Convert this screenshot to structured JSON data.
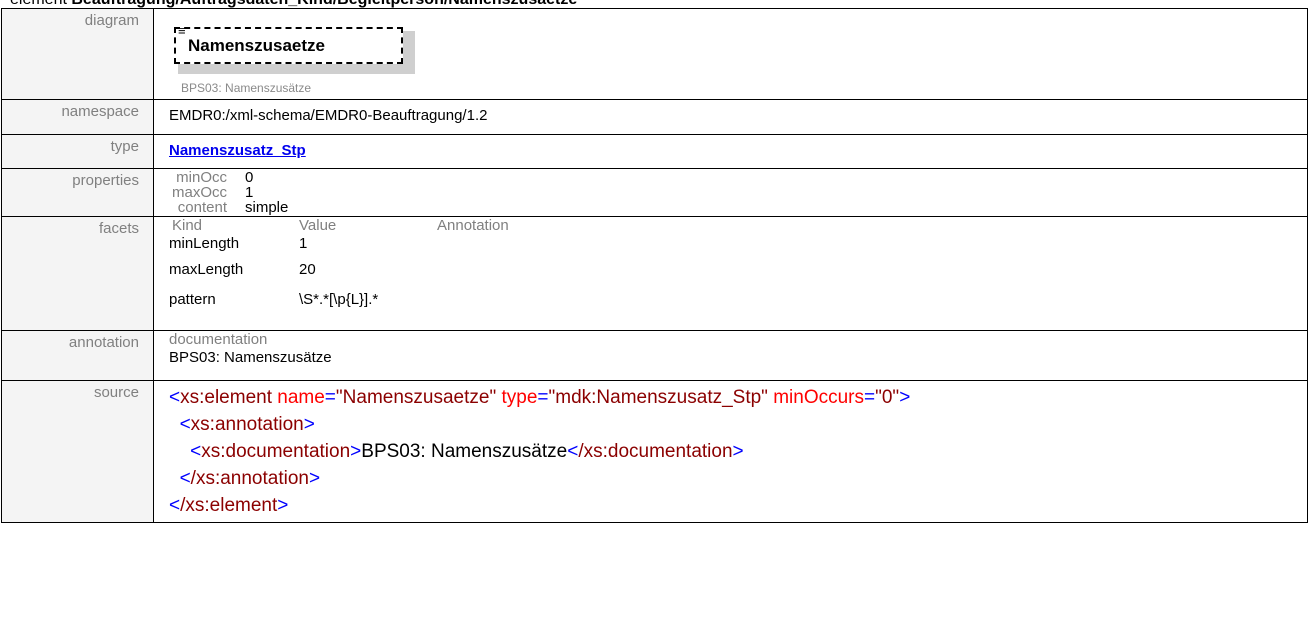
{
  "header": {
    "kind": "element",
    "path": "Beauftragung/Auftragsdaten_Kind/Begleitperson/Namenszusaetze"
  },
  "labels": {
    "diagram": "diagram",
    "namespace": "namespace",
    "type": "type",
    "properties": "properties",
    "facets": "facets",
    "annotation": "annotation",
    "source": "source"
  },
  "diagram": {
    "element_name": "Namenszusaetze",
    "caption": "BPS03: Namenszusätze",
    "marker": "≡"
  },
  "namespace": "EMDR0:/xml-schema/EMDR0-Beauftragung/1.2",
  "type": "Namenszusatz_Stp",
  "properties": [
    {
      "key": "minOcc",
      "value": "0"
    },
    {
      "key": "maxOcc",
      "value": "1"
    },
    {
      "key": "content",
      "value": "simple"
    }
  ],
  "facets": {
    "headers": [
      "Kind",
      "Value",
      "Annotation"
    ],
    "rows": [
      {
        "kind": "minLength",
        "value": "1",
        "annotation": ""
      },
      {
        "kind": "maxLength",
        "value": "20",
        "annotation": ""
      },
      {
        "kind": "pattern",
        "value": "\\S*.*[\\p{L}].*",
        "annotation": ""
      }
    ]
  },
  "annotation": {
    "label": "documentation",
    "text": "BPS03: Namenszusätze"
  },
  "source": {
    "element_open_tag": "xs:element",
    "attrs": [
      {
        "name": "name",
        "value": "\"Namenszusaetze\""
      },
      {
        "name": "type",
        "value": "\"mdk:Namenszusatz_Stp\""
      },
      {
        "name": "minOccurs",
        "value": "\"0\""
      }
    ],
    "annotation_tag": "xs:annotation",
    "documentation_tag": "xs:documentation",
    "documentation_text": "BPS03: Namenszusätze",
    "documentation_close": "/xs:documentation",
    "annotation_close": "/xs:annotation",
    "element_close": "/xs:element"
  },
  "colors": {
    "tag": "#8b0000",
    "bracket": "#0000ff",
    "attribute": "#ff0000",
    "link": "#0000ee"
  }
}
